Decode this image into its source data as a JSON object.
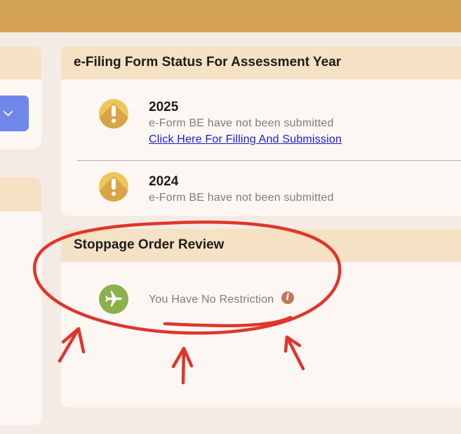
{
  "efiling": {
    "title": "e-Filing Form Status For Assessment Year",
    "items": [
      {
        "year": "2025",
        "status": "e-Form BE have not been submitted",
        "link": "Click Here For Filling And Submission",
        "icon": "warning-icon",
        "icon_color": "#ebc75a"
      },
      {
        "year": "2024",
        "status": "e-Form BE have not been submitted",
        "icon": "warning-icon",
        "icon_color": "#ebc75a"
      }
    ]
  },
  "stoppage": {
    "title": "Stoppage Order Review",
    "message": "You Have No Restriction",
    "icon": "airplane-icon",
    "icon_color": "#89b24a",
    "info_icon": "info-icon",
    "info_glyph": "i"
  },
  "sidebar": {
    "dropdown_icon": "chevron-down-icon",
    "dropdown_color": "#6f86ea"
  },
  "annotation": {
    "color": "#e0352b",
    "shapes": [
      "ellipse",
      "arrow",
      "arrow",
      "arrow"
    ]
  },
  "colors": {
    "top_bar": "#d4a356",
    "card_header": "#f5e1c4",
    "card_body": "#fdf7f4",
    "link": "#1a1ad6"
  }
}
